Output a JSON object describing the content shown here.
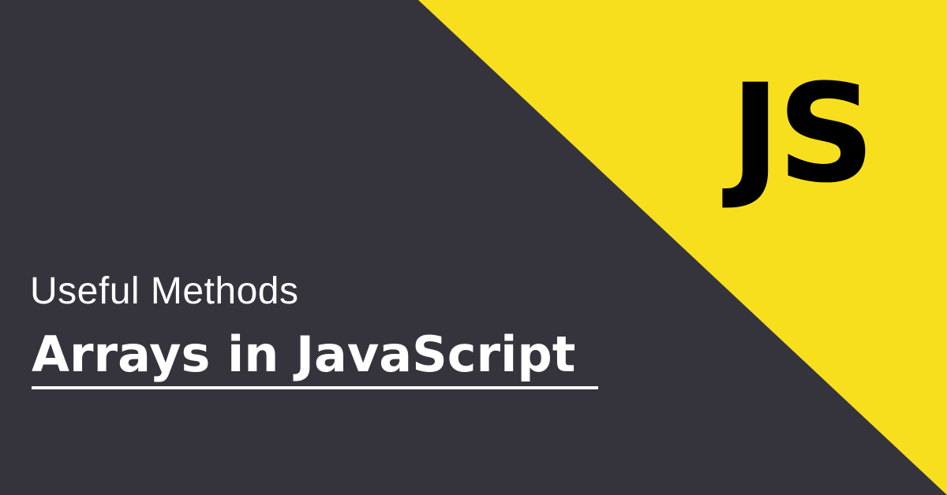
{
  "logo": {
    "text": "JS",
    "accent_color": "#f7df1e",
    "text_color": "#000000"
  },
  "background_color": "#35343d",
  "subtitle": "Useful Methods",
  "title": "Arrays in JavaScript"
}
